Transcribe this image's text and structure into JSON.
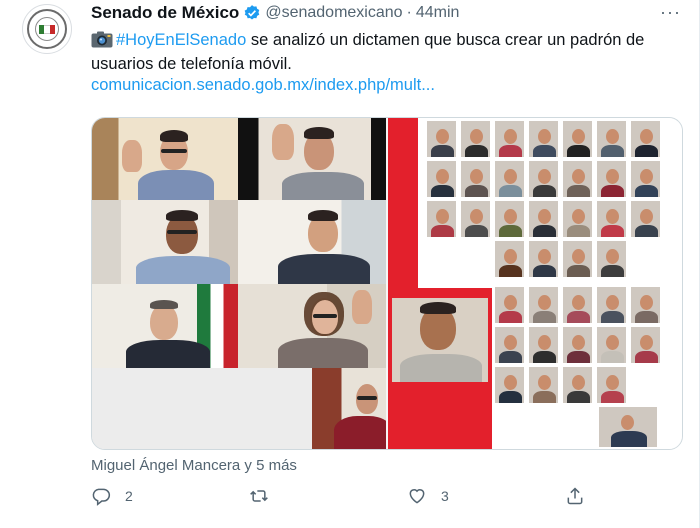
{
  "account": {
    "name": "Senado de México",
    "handle": "@senadomexicano",
    "separator": "·",
    "time": "44min",
    "more_label": "···"
  },
  "tweet": {
    "hashtag": "#HoyEnElSenado",
    "text": " se analizó un dictamen que busca crear un padrón de usuarios de telefonía móvil.",
    "link": "comunicacion.senado.gob.mx/index.php/mult..."
  },
  "social": {
    "liked_by": "Miguel Ángel Mancera y 5 más"
  },
  "actions": {
    "reply_count": "2",
    "retweet_count": "",
    "like_count": "3"
  },
  "colors": {
    "accent": "#1d9bf0",
    "muted": "#536471",
    "senate_red": "#e3202c"
  },
  "icons": [
    "camera-icon",
    "verified-badge-icon",
    "more-options-icon",
    "reply-icon",
    "retweet-icon",
    "like-icon",
    "share-icon"
  ]
}
